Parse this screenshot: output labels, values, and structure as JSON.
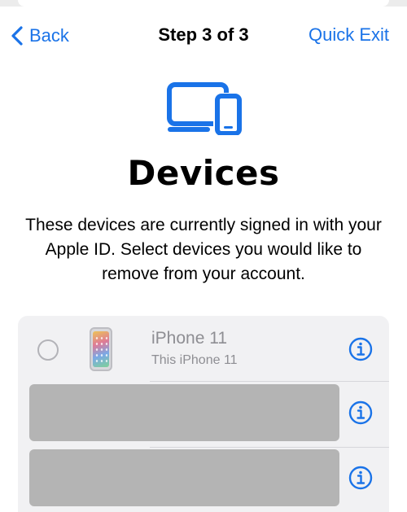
{
  "nav": {
    "back_label": "Back",
    "title": "Step 3 of 3",
    "quick_exit_label": "Quick Exit"
  },
  "header": {
    "icon": "devices-icon",
    "title": "Devices",
    "description": "These devices are currently signed in with your Apple ID. Select devices you would like to remove from your account."
  },
  "devices": [
    {
      "name": "iPhone 11",
      "subtitle": "This iPhone 11",
      "selected": false,
      "redacted": false
    },
    {
      "name": "",
      "subtitle": "",
      "selected": false,
      "redacted": true
    },
    {
      "name": "",
      "subtitle": "",
      "selected": false,
      "redacted": true
    }
  ],
  "colors": {
    "accent": "#1a73e8",
    "background": "#ffffff",
    "card_background": "#f1f1f3",
    "secondary_text": "#8e8e93",
    "redaction": "#b4b4b4"
  }
}
